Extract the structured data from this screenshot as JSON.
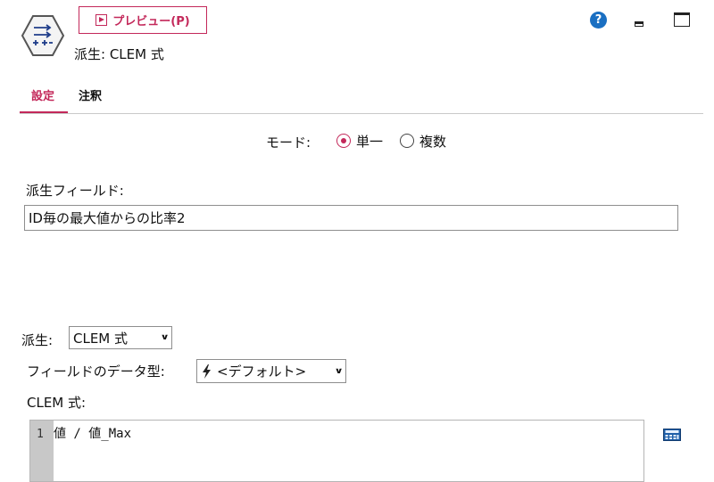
{
  "header": {
    "preview_label": "プレビュー(P)",
    "node_title": "派生: CLEM 式"
  },
  "icons": {
    "node": "derive-node-icon",
    "help": "help-icon",
    "help_glyph": "?",
    "minimize": "minimize-icon",
    "maximize": "maximize-icon",
    "calculator": "expression-builder-icon"
  },
  "colors": {
    "accent": "#c3285a",
    "help": "#1a6fc2",
    "calculator": "#1f5fa8"
  },
  "tabs": [
    {
      "label": "設定",
      "active": true
    },
    {
      "label": "注釈",
      "active": false
    }
  ],
  "mode": {
    "label": "モード:",
    "options": [
      {
        "label": "単一",
        "selected": true
      },
      {
        "label": "複数",
        "selected": false
      }
    ]
  },
  "derive_field": {
    "label": "派生フィールド:",
    "value": "ID毎の最大値からの比率2"
  },
  "derive_as": {
    "label": "派生:",
    "value": "CLEM 式"
  },
  "field_type": {
    "label": "フィールドのデータ型:",
    "value": "<デフォルト>"
  },
  "clem": {
    "label": "CLEM 式:",
    "line_number": "1",
    "code": "値 / 値_Max"
  }
}
